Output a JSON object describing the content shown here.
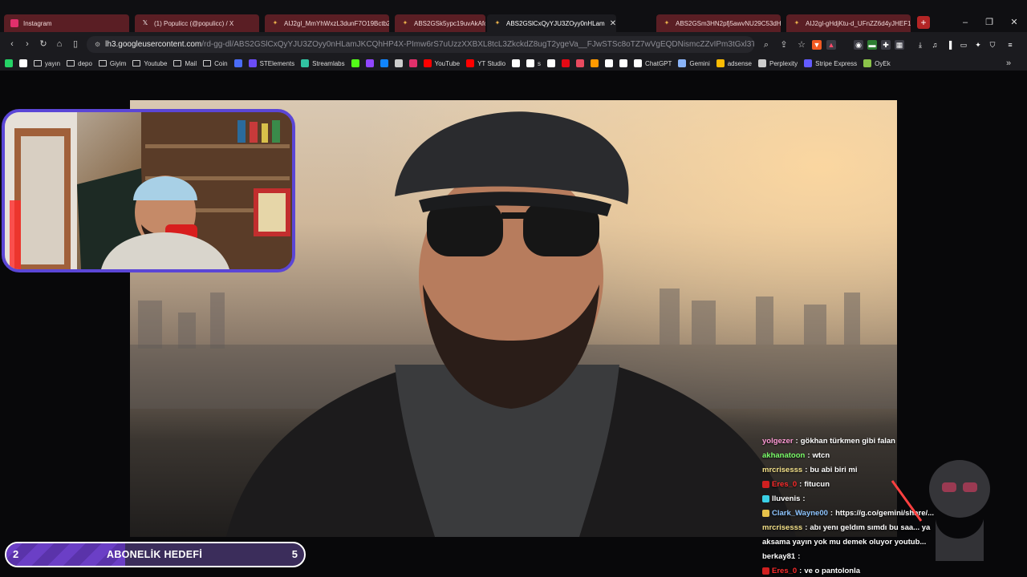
{
  "tabs": [
    {
      "title": "Instagram",
      "favicon": "instagram-icon",
      "color": "#5a1e24"
    },
    {
      "title": "(1) Populicc (@populicc) / X",
      "favicon": "x-icon",
      "color": "#5a1e24"
    },
    {
      "title": "AIJ2gl_MmYhWxzL3dunF7O19Bctb2",
      "favicon": "gemini-icon",
      "color": "#5a1e24"
    },
    {
      "title": "ABS2GSk5ypc19uvAkAfo1",
      "favicon": "gemini-icon",
      "color": "#5a1e24"
    },
    {
      "title": "ABS2GSlCxQyYJU3ZOyy0nHLam",
      "favicon": "gemini-icon",
      "active": true
    },
    {
      "title": "ABS2GSm3HN2pfj5awvNU29C53dH",
      "favicon": "gemini-icon",
      "color": "#5a1e24"
    },
    {
      "title": "AIJ2gl-gHdjKtu-d_UFnZZ6d4yJHEF1",
      "favicon": "gemini-icon",
      "color": "#5a1e24"
    }
  ],
  "address_bar": {
    "host": "lh3.googleusercontent.com",
    "path": "/rd-gg-dl/ABS2GSlCxQyYJU3ZOyy0nHLamJKCQhHP4X-PImw6rS7uUzzXXBXL8tcL3ZkckdZ8ugT2ygeVa__FJwSTSc8oTZ7wVgEQDNismcZZvIPm3tGxl3TtTLBpuSwWZIiqRkK..."
  },
  "bookmarks": [
    {
      "label": "",
      "icon": "whatsapp-icon",
      "color": "#25d366"
    },
    {
      "label": "",
      "icon": "google-icon",
      "color": "#ffffff"
    },
    {
      "label": "yayın",
      "icon": "folder-icon"
    },
    {
      "label": "depo",
      "icon": "folder-icon"
    },
    {
      "label": "Giyim",
      "icon": "folder-icon"
    },
    {
      "label": "Youtube",
      "icon": "folder-icon"
    },
    {
      "label": "Mail",
      "icon": "folder-icon"
    },
    {
      "label": "Coin",
      "icon": "folder-icon"
    },
    {
      "label": "",
      "icon": "r-icon",
      "color": "#4a6cf7"
    },
    {
      "label": "STElements",
      "icon": "st-icon",
      "color": "#6b4cf7"
    },
    {
      "label": "Streamlabs",
      "icon": "streamlabs-icon",
      "color": "#31c3a2"
    },
    {
      "label": "",
      "icon": "kick-icon",
      "color": "#53fc18"
    },
    {
      "label": "",
      "icon": "twitch-icon",
      "color": "#9146ff"
    },
    {
      "label": "",
      "icon": "bluesky-icon",
      "color": "#1185fe"
    },
    {
      "label": "",
      "icon": "x-icon",
      "color": "#cccccc"
    },
    {
      "label": "",
      "icon": "instagram-icon",
      "color": "#e1306c"
    },
    {
      "label": "YouTube",
      "icon": "youtube-icon",
      "color": "#ff0000"
    },
    {
      "label": "YT Studio",
      "icon": "yt-studio-icon",
      "color": "#ff0000"
    },
    {
      "label": "",
      "icon": "tiktok-icon",
      "color": "#ffffff"
    },
    {
      "label": "s",
      "icon": "tiktok-icon",
      "color": "#ffffff"
    },
    {
      "label": "",
      "icon": "threads-icon",
      "color": "#ffffff"
    },
    {
      "label": "",
      "icon": "netflix-icon",
      "color": "#e50914"
    },
    {
      "label": "",
      "icon": "discord-icon",
      "color": "#e84a5f"
    },
    {
      "label": "",
      "icon": "amazon-icon",
      "color": "#ff9900"
    },
    {
      "label": "",
      "icon": "bookmark-icon",
      "color": "#ffffff"
    },
    {
      "label": "",
      "icon": "grok-icon",
      "color": "#ffffff"
    },
    {
      "label": "ChatGPT",
      "icon": "chatgpt-icon",
      "color": "#ffffff"
    },
    {
      "label": "Gemini",
      "icon": "gemini-icon",
      "color": "#8ab4f8"
    },
    {
      "label": "adsense",
      "icon": "adsense-icon",
      "color": "#fbbc04"
    },
    {
      "label": "Perplexity",
      "icon": "perplexity-icon",
      "color": "#cccccc"
    },
    {
      "label": "Stripe Express",
      "icon": "stripe-icon",
      "color": "#635bff"
    },
    {
      "label": "OyEk",
      "icon": "oyek-icon",
      "color": "#8bc34a"
    }
  ],
  "chat": [
    {
      "user": "yolgezer",
      "user_color": "#ff9ad5",
      "message": "gökhan türkmen gibi falan"
    },
    {
      "user": "akhanatoon",
      "user_color": "#7cff6b",
      "message": "wtcn"
    },
    {
      "user": "mrcrisesss",
      "user_color": "#f5e28a",
      "message": "bu abi biri mi"
    },
    {
      "user": "Eres_0",
      "user_color": "#ff2b2b",
      "message": "fitucun",
      "badge": "#d02020"
    },
    {
      "user": "lluvenis",
      "user_color": "#ffffff",
      "message": "",
      "badge": "#3ad0e6"
    },
    {
      "user": "Clark_Wayne00",
      "user_color": "#8ec5ff",
      "message": "https://g.co/gemini/share/...",
      "badge": "#e6c24a"
    },
    {
      "user": "mrcrisesss",
      "user_color": "#f5e28a",
      "message": "abı yenı geldım sımdı bu saa... ya"
    },
    {
      "user": "",
      "user_color": "#ffffff",
      "message": "aksama yayın yok mu demek oluyor youtub..."
    },
    {
      "user": "berkay81",
      "user_color": "#ffffff",
      "message": ""
    },
    {
      "user": "Eres_0",
      "user_color": "#ff2b2b",
      "message": "ve o pantolonla",
      "badge": "#d02020"
    }
  ],
  "goal": {
    "current": "2",
    "label": "ABONELİK HEDEFİ",
    "target": "5",
    "progress": 0.4
  }
}
